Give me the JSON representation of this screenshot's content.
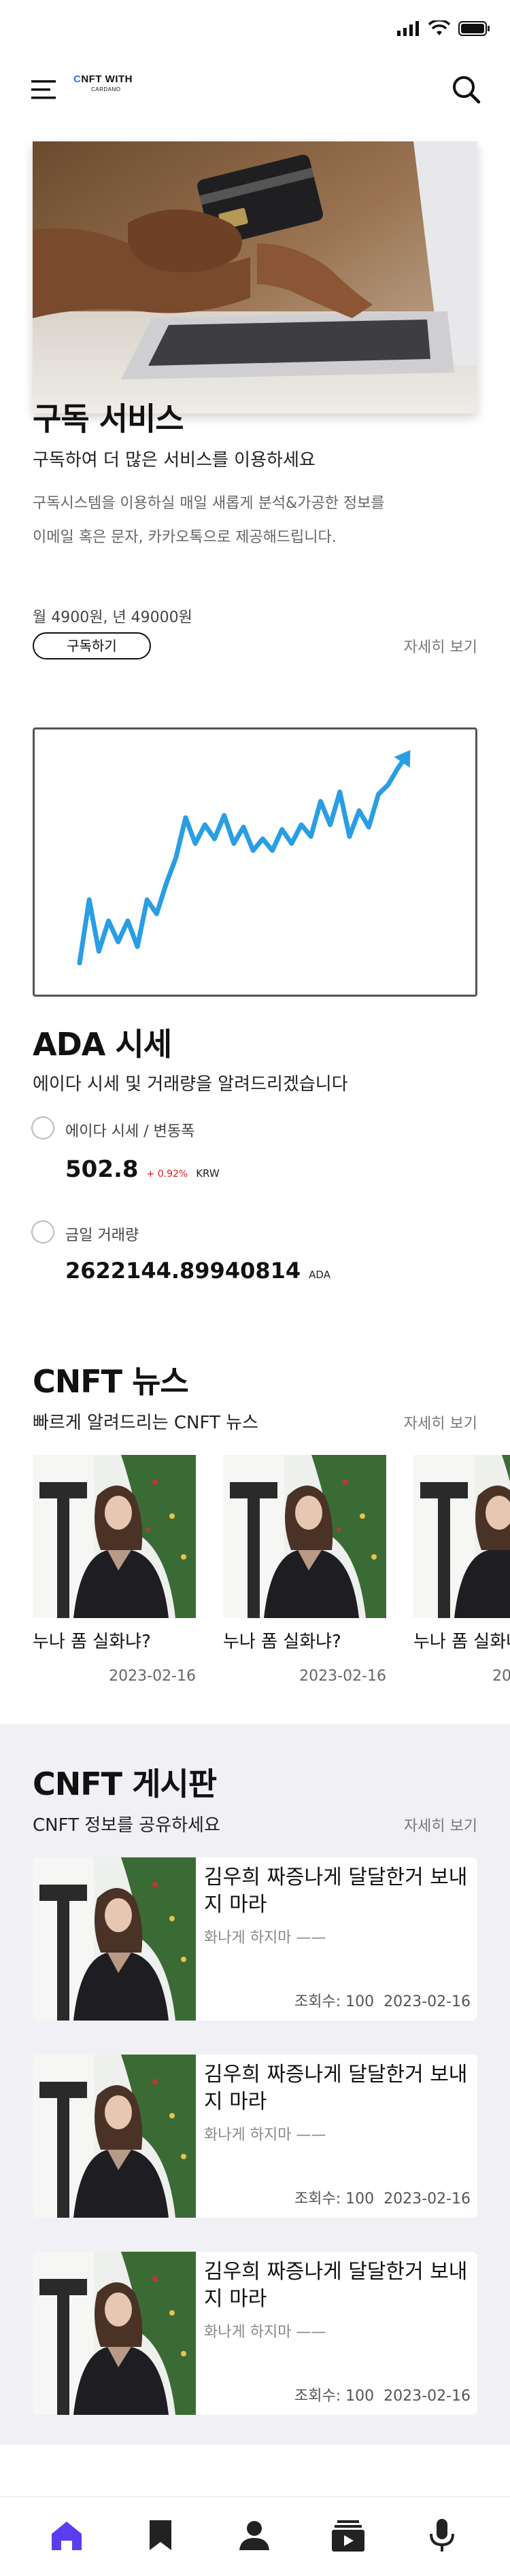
{
  "header": {
    "logo_line1_c": "C",
    "logo_line1_rest": "NFT WITH",
    "logo_line2": "CARDANO"
  },
  "subscription": {
    "title": "구독 서비스",
    "subtitle": "구독하여 더 많은 서비스를 이용하세요",
    "desc_line1": "구독시스템을 이용하실 매일 새롭게 분석&가공한 정보를",
    "desc_line2": "이메일 혹은 문자, 카카오톡으로 제공해드립니다.",
    "price": "월 4900원, 년 49000원",
    "subscribe_label": "구독하기",
    "more_label": "자세히 보기"
  },
  "ada": {
    "title": "ADA 시세",
    "subtitle": "에이다 시세 및 거래량을 알려드리겠습니다",
    "price_label": "에이다 시세 / 변동폭",
    "price_value": "502.8",
    "price_change": "+ 0.92%",
    "price_unit": "KRW",
    "volume_label": "금일 거래량",
    "volume_value": "2622144.89940814",
    "volume_unit": "ADA",
    "accent_color": "#2a9ee3"
  },
  "chart_data": {
    "type": "line",
    "title": "",
    "xlabel": "",
    "ylabel": "",
    "grid": false,
    "legend": "none",
    "x": [
      0,
      1,
      2,
      3,
      4,
      5,
      6,
      7,
      8,
      9,
      10,
      11,
      12,
      13,
      14,
      15,
      16,
      17,
      18,
      19,
      20,
      21,
      22,
      23,
      24,
      25,
      26,
      27,
      28,
      29,
      30,
      31,
      32,
      33,
      34
    ],
    "series": [
      {
        "values": [
          10,
          37,
          15,
          28,
          19,
          28,
          17,
          37,
          31,
          44,
          55,
          72,
          61,
          69,
          63,
          73,
          61,
          68,
          58,
          63,
          58,
          67,
          61,
          69,
          64,
          79,
          69,
          83,
          64,
          75,
          68,
          82,
          86,
          93,
          99
        ]
      }
    ],
    "ylim": [
      0,
      105
    ]
  },
  "news": {
    "title": "CNFT 뉴스",
    "subtitle": "빠르게 알려드리는 CNFT 뉴스",
    "more_label": "자세히 보기",
    "items": [
      {
        "title": "누나 폼 실화냐?",
        "date": "2023-02-16"
      },
      {
        "title": "누나 폼 실화냐?",
        "date": "2023-02-16"
      },
      {
        "title": "누나 폼 실화냐?",
        "date": "20"
      }
    ]
  },
  "board": {
    "title": "CNFT 게시판",
    "subtitle": "CNFT 정보를 공유하세요",
    "more_label": "자세히 보기",
    "posts": [
      {
        "title": "김우희 짜증나게 달달한거 보내지 마라",
        "desc": "화나게 하지마 ——",
        "views": "조회수: 100",
        "date": "2023-02-16"
      },
      {
        "title": "김우희 짜증나게 달달한거 보내지 마라",
        "desc": "화나게 하지마 ——",
        "views": "조회수: 100",
        "date": "2023-02-16"
      },
      {
        "title": "김우희 짜증나게 달달한거 보내지 마라",
        "desc": "화나게 하지마 ——",
        "views": "조회수: 100",
        "date": "2023-02-16"
      }
    ]
  },
  "tabbar": {
    "active_color": "#5b3cf0",
    "inactive_color": "#222222",
    "items": [
      "home-icon",
      "bookmark-icon",
      "user-icon",
      "media-icon",
      "mic-icon"
    ]
  }
}
